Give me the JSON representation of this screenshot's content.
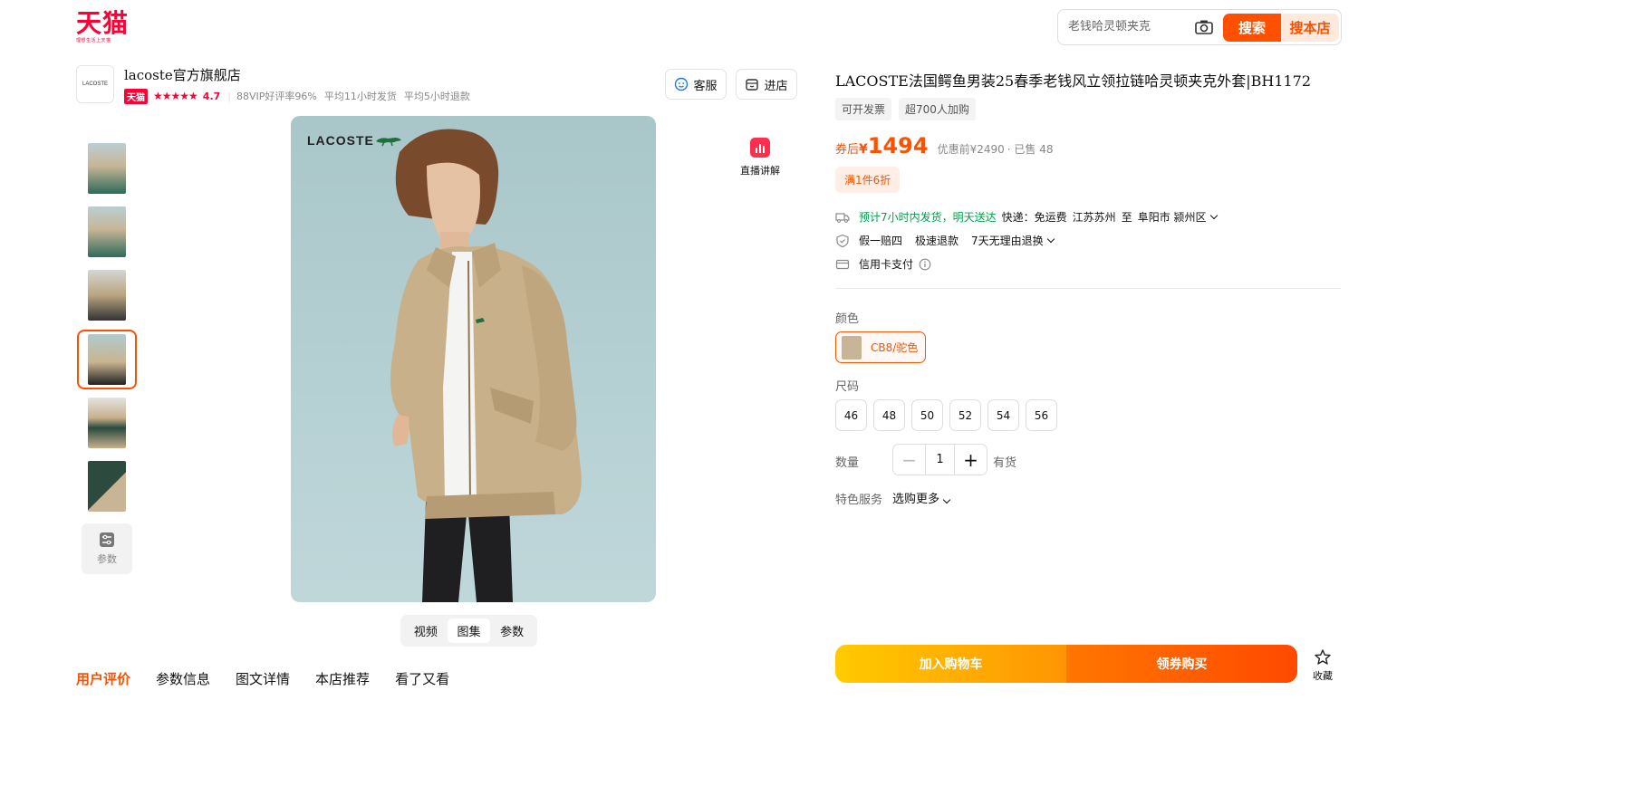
{
  "header": {
    "logo_text": "天猫",
    "logo_sub": "理想生活上天猫",
    "search_placeholder": "老钱哈灵顿夹克",
    "search_button": "搜索",
    "search_shop_button": "搜本店"
  },
  "store": {
    "logo_text": "LACOSTE",
    "name": "lacoste官方旗舰店",
    "badge": "天猫",
    "stars": "★★★★★",
    "rating": "4.7",
    "vip_rate": "88VIP好评率96%",
    "ship_time": "平均11小时发货",
    "refund_time": "平均5小时退款",
    "service_button": "客服",
    "enter_shop_button": "进店"
  },
  "gallery": {
    "brand_text": "LACOSTE",
    "live_label": "直播讲解",
    "params_thumb_label": "参数",
    "view_tabs": [
      "视频",
      "图集",
      "参数"
    ],
    "active_view_tab": "图集"
  },
  "bottom_nav": [
    "用户评价",
    "参数信息",
    "图文详情",
    "本店推荐",
    "看了又看"
  ],
  "product": {
    "title": "LACOSTE法国鳄鱼男装25春季老钱风立领拉链哈灵顿夹克外套|BH1172",
    "tags": [
      "可开发票",
      "超700人加购"
    ],
    "price_label": "券后",
    "currency": "¥",
    "price": "1494",
    "original_price": "优惠前¥2490",
    "sold": "· 已售 48",
    "discount": "满1件6折",
    "delivery_estimate": "预计7小时内发货，明天送达",
    "shipping_label": "快递：",
    "shipping_fee": "免运费",
    "from": "江苏苏州",
    "to_word": "至",
    "destination": "阜阳市 颍州区",
    "guarantees": [
      "假一赔四",
      "极速退款",
      "7天无理由退换"
    ],
    "payment": "信用卡支付",
    "color_label": "颜色",
    "color_option": "CB8/驼色",
    "size_label": "尺码",
    "sizes": [
      "46",
      "48",
      "50",
      "52",
      "54",
      "56"
    ],
    "quantity_label": "数量",
    "quantity": "1",
    "stock": "有货",
    "service_label": "特色服务",
    "service_more": "选购更多",
    "add_to_cart": "加入购物车",
    "buy_with_coupon": "领券购买",
    "favorite": "收藏"
  },
  "colors": {
    "accent": "#ff5000",
    "tmall_red": "#ff0036",
    "delivery_green": "#00a04c",
    "cart_yellow": "#ffcb00"
  }
}
